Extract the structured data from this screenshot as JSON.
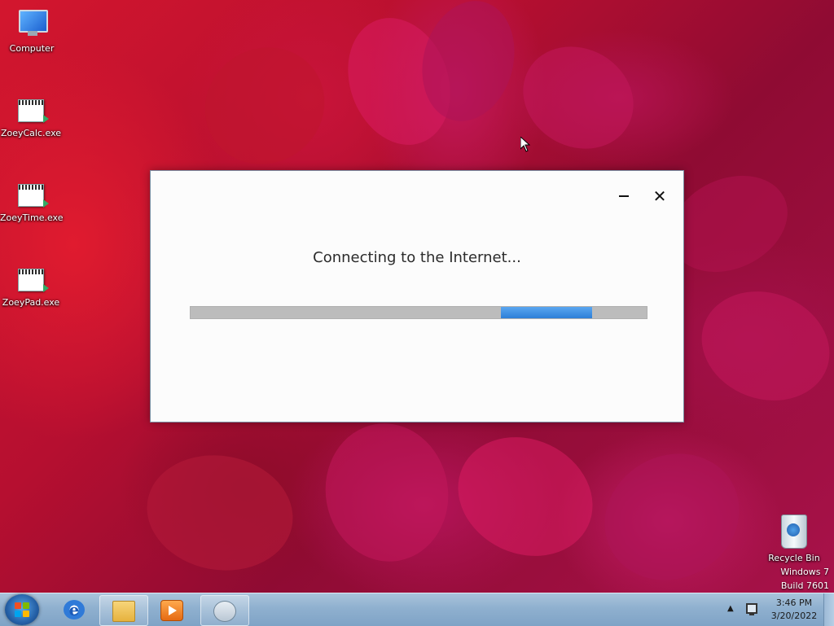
{
  "desktop": {
    "icons": [
      {
        "label": "Computer",
        "icon": "computer-icon"
      },
      {
        "label": "ZoeyCalc.exe",
        "icon": "executable-icon"
      },
      {
        "label": "ZoeyTime.exe",
        "icon": "executable-icon"
      },
      {
        "label": "ZoeyPad.exe",
        "icon": "executable-icon"
      },
      {
        "label": "Recycle Bin",
        "icon": "recycle-bin-icon"
      }
    ],
    "watermark": {
      "line1": "Windows 7",
      "line2": "Build 7601"
    }
  },
  "dialog": {
    "message": "Connecting to the Internet...",
    "minimize_icon": "minimize-icon",
    "close_symbol": "✕",
    "progress": {
      "mode": "indeterminate",
      "chunk_start": 0.68,
      "chunk_end": 0.88,
      "track_color": "#bcbcbc",
      "chunk_color": "#3b8de0"
    }
  },
  "taskbar": {
    "start_icon": "windows-start-icon",
    "pinned": [
      "internet-explorer-icon",
      "file-explorer-icon",
      "media-player-icon",
      "app-icon"
    ],
    "tray_arrow": "▲",
    "time": "3:46 PM",
    "date": "3/20/2022"
  },
  "colors": {
    "taskbar": "#8fb0cf",
    "dialog_bg": "#fcfcfc",
    "wallpaper": "#b0102e"
  }
}
